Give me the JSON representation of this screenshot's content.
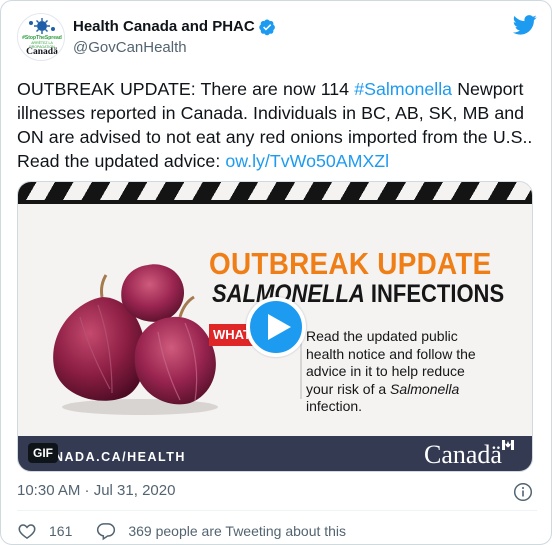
{
  "account": {
    "display_name": "Health Canada and PHAC",
    "handle": "@GovCanHealth",
    "avatar": {
      "hashtag": "#StopTheSpread",
      "tagline": "ARRÊTEZ LA PROPAGATION",
      "wordmark": "Canadä"
    }
  },
  "tweet": {
    "text_before": "OUTBREAK UPDATE: There are now 114 ",
    "hashtag": "#Salmonella",
    "text_middle": " Newport illnesses reported in Canada. Individuals in BC, AB, SK, MB and ON are advised to not eat any red onions imported from the U.S.. Read the updated advice: ",
    "link": "ow.ly/TvWo50AMXZl",
    "timestamp": "10:30 AM · Jul 31, 2020"
  },
  "media": {
    "headline_line1": "OUTBREAK UPDATE",
    "headline_line2_italic": "SALMONELLA",
    "headline_line2_rest": " INFECTIONS",
    "badge_label": "WHAT",
    "advice_text": "Read the updated public health notice and follow the advice in it to help reduce your risk of a ",
    "advice_italic": "Salmonella",
    "advice_end": " infection.",
    "gif_label": "GIF",
    "site_label": "NADA.CA/HEALTH",
    "wordmark": "Canadä"
  },
  "engagement": {
    "likes": "161",
    "replies_text": "369 people are Tweeting about this"
  },
  "colors": {
    "link": "#1d9bf0",
    "headline_orange": "#f07e16",
    "band_navy": "#333a52",
    "badge_red": "#e02727"
  },
  "icons": [
    "verified-badge-icon",
    "twitter-bird-icon",
    "play-icon",
    "info-icon",
    "heart-icon",
    "comment-icon"
  ]
}
